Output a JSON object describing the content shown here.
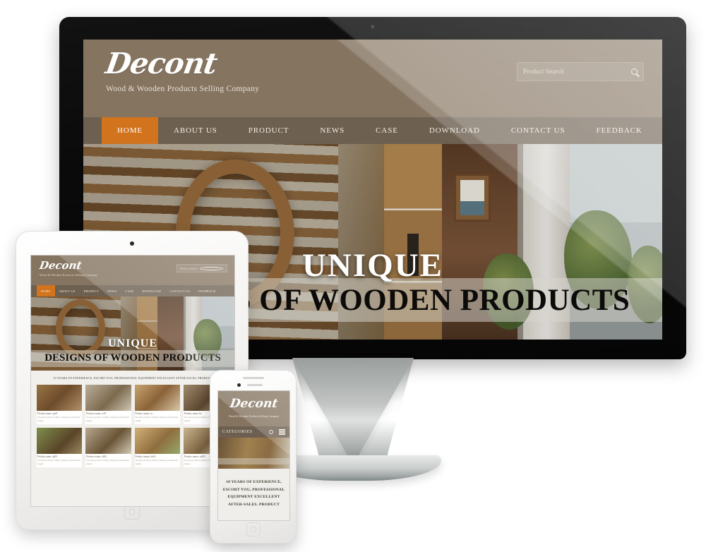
{
  "brand": {
    "name": "Decont",
    "tagline": "Wood & Wooden Products Selling Company"
  },
  "search": {
    "placeholder": "Product Search",
    "value": "",
    "icon": "search-icon"
  },
  "nav": {
    "items": [
      {
        "label": "HOME",
        "active": true
      },
      {
        "label": "ABOUT US",
        "active": false
      },
      {
        "label": "PRODUCT",
        "active": false
      },
      {
        "label": "NEWS",
        "active": false
      },
      {
        "label": "CASE",
        "active": false
      },
      {
        "label": "DOWNLOAD",
        "active": false
      },
      {
        "label": "CONTACT US",
        "active": false
      },
      {
        "label": "FEEDBACK",
        "active": false
      }
    ]
  },
  "hero": {
    "line1": "UNIQUE",
    "line2": "DESIGNS OF WOODEN PRODUCTS"
  },
  "slogan": "10 YEARS OF EXPERIENCE, ESCORT YOU, PROFESSIONAL EQUIPMENT EXCELLENT AFTER-SALES. PRODUCT",
  "phone": {
    "categories_label": "CATEGORIES",
    "search_icon": "search-icon",
    "menu_icon": "hamburger-menu-icon",
    "slogan": "10 YEARS OF EXPERIENCE, ESCORT YOU, PROFESSIONAL EQUIPMENT EXCELLENT AFTER-SALES. PRODUCT"
  },
  "tablet": {
    "slogan": "10 YEARS OF EXPERIENCE, ESCORT YOU, PROFESSIONAL EQUIPMENT EXCELLENT AFTER-SALES. PRODUCT",
    "products": [
      {
        "name": "Product name: sp01",
        "desc": "Wooden products selling company professional supply"
      },
      {
        "name": "Product name: sc01",
        "desc": "Wooden products selling company professional supply"
      },
      {
        "name": "Product name: ta",
        "desc": "Wooden products selling company professional supply"
      },
      {
        "name": "Product name: bc",
        "desc": "Wooden products selling company professional supply"
      },
      {
        "name": "Product name: pl02",
        "desc": "Wooden products selling company professional supply"
      },
      {
        "name": "Product name: ch03",
        "desc": "Wooden products selling company professional supply"
      },
      {
        "name": "Product name: hs04",
        "desc": "Wooden products selling company professional supply"
      },
      {
        "name": "Product name: wd05",
        "desc": "Wooden products selling company professional supply"
      }
    ]
  },
  "colors": {
    "header_bg": "#857460",
    "nav_bg": "#6d6050",
    "accent": "#d2741e",
    "bezel": "#0a0a0a",
    "stand": "#b9bcbb"
  }
}
